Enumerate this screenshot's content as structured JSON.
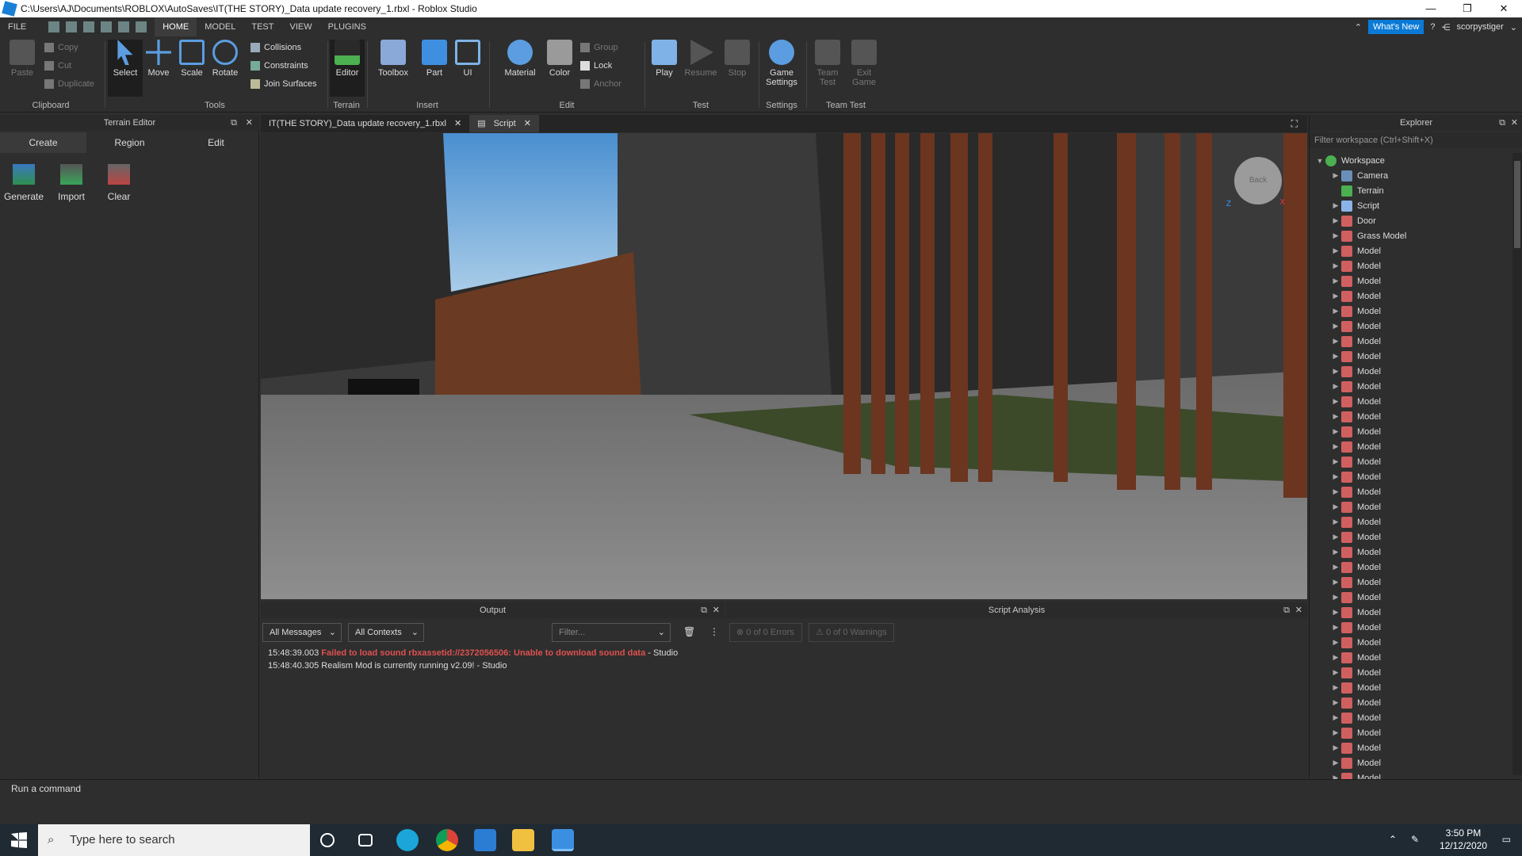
{
  "window": {
    "title": "C:\\Users\\AJ\\Documents\\ROBLOX\\AutoSaves\\IT(THE STORY)_Data update recovery_1.rbxl - Roblox Studio",
    "controls": [
      "—",
      "❐",
      "✕"
    ]
  },
  "menu": {
    "file": "FILE",
    "tabs": [
      "HOME",
      "MODEL",
      "TEST",
      "VIEW",
      "PLUGINS"
    ],
    "active": "HOME",
    "whats_new": "What's New",
    "user": "scorpystiger"
  },
  "ribbon": {
    "clipboard": {
      "label": "Clipboard",
      "paste": "Paste",
      "copy": "Copy",
      "cut": "Cut",
      "duplicate": "Duplicate"
    },
    "tools": {
      "label": "Tools",
      "select": "Select",
      "move": "Move",
      "scale": "Scale",
      "rotate": "Rotate",
      "collisions": "Collisions",
      "constraints": "Constraints",
      "join_surfaces": "Join Surfaces"
    },
    "terrain": {
      "label": "Terrain",
      "editor": "Editor"
    },
    "insert": {
      "label": "Insert",
      "toolbox": "Toolbox",
      "part": "Part",
      "ui": "UI"
    },
    "edit": {
      "label": "Edit",
      "material": "Material",
      "color": "Color",
      "group": "Group",
      "lock": "Lock",
      "anchor": "Anchor"
    },
    "test": {
      "label": "Test",
      "play": "Play",
      "resume": "Resume",
      "stop": "Stop"
    },
    "settings": {
      "label": "Settings",
      "game_settings_1": "Game",
      "game_settings_2": "Settings"
    },
    "team_test": {
      "label": "Team Test",
      "team_test_1": "Team",
      "team_test_2": "Test",
      "exit_game_1": "Exit",
      "exit_game_2": "Game"
    }
  },
  "terrain_editor": {
    "title": "Terrain Editor",
    "tabs": [
      "Create",
      "Region",
      "Edit"
    ],
    "tools": [
      "Generate",
      "Import",
      "Clear"
    ]
  },
  "doc_tabs": [
    {
      "label": "IT(THE STORY)_Data update recovery_1.rbxl"
    },
    {
      "label": "Script"
    }
  ],
  "viewcube": {
    "back": "Back",
    "z": "Z",
    "x": "X"
  },
  "output": {
    "title": "Output",
    "messages_filter": "All Messages",
    "contexts_filter": "All Contexts",
    "filter_placeholder": "Filter...",
    "lines": [
      {
        "time": "15:48:39.003",
        "text": "Failed to load sound rbxassetid://2372056506: Unable to download sound data",
        "suffix": " - Studio"
      },
      {
        "time": "15:48:40.305",
        "text": "Realism Mod is currently running v2.09!",
        "suffix": " - Studio"
      }
    ]
  },
  "script_analysis": {
    "title": "Script Analysis",
    "errors": "0 of 0 Errors",
    "warnings": "0 of 0 Warnings"
  },
  "explorer": {
    "title": "Explorer",
    "filter_placeholder": "Filter workspace (Ctrl+Shift+X)",
    "root": "Workspace",
    "items": [
      "Camera",
      "Terrain",
      "Script",
      "Door",
      "Grass Model",
      "Model",
      "Model",
      "Model",
      "Model",
      "Model",
      "Model",
      "Model",
      "Model",
      "Model",
      "Model",
      "Model",
      "Model",
      "Model",
      "Model",
      "Model",
      "Model",
      "Model",
      "Model",
      "Model",
      "Model",
      "Model",
      "Model",
      "Model",
      "Model",
      "Model",
      "Model",
      "Model",
      "Model",
      "Model",
      "Model",
      "Model",
      "Model",
      "Model",
      "Model",
      "Model",
      "Model",
      "Model"
    ]
  },
  "command_bar": {
    "placeholder": "Run a command"
  },
  "taskbar": {
    "search_placeholder": "Type here to search",
    "time": "3:50 PM",
    "date": "12/12/2020"
  },
  "colors": {
    "accent": "#0a7ad6",
    "error": "#e05050",
    "panel": "#2e2e2e"
  }
}
